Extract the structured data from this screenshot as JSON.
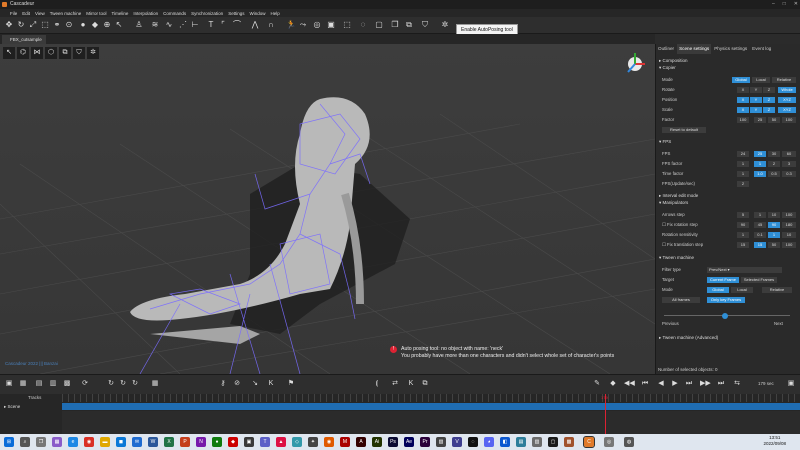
{
  "window": {
    "title": "Cascadeur"
  },
  "menu": [
    "File",
    "Edit",
    "View",
    "Tween machine",
    "Mirror tool",
    "Timeline",
    "Interpolation",
    "Commands",
    "Synchronization",
    "Settings",
    "Window",
    "Help"
  ],
  "toolbar_tooltip": "Enable AutoPosing tool",
  "scene_tab": "FBX_cutsample",
  "viewport": {
    "copyright": "Cascadeur 2022 ||| Banzai",
    "warning_line1": "Auto posing tool: no object with name: 'neck'",
    "warning_line2": "You probably have more than one characters and didn't select whole set of character's points"
  },
  "panel": {
    "tabs": [
      "Outliner",
      "Scene settings",
      "Physics settings",
      "Event log"
    ],
    "active_tab": "Scene settings",
    "composition": "Composition",
    "copier": "Copier",
    "mode": {
      "label": "Mode",
      "options": [
        "Global",
        "Local",
        "Relative"
      ]
    },
    "rotate": {
      "label": "Rotate",
      "options": [
        "X",
        "Y",
        "Z",
        "Whole"
      ]
    },
    "position": {
      "label": "Position",
      "options": [
        "X",
        "Y",
        "Z",
        "XYZ"
      ]
    },
    "scale": {
      "label": "Scale",
      "options": [
        "X",
        "Y",
        "Z",
        "XYZ"
      ]
    },
    "factor": {
      "label": "Factor",
      "options": [
        "100",
        "25",
        "50",
        "100"
      ]
    },
    "reset": "Reset to default",
    "fps_section": "FPS",
    "fps": {
      "label": "FPS",
      "options": [
        "24",
        "25",
        "30",
        "60"
      ]
    },
    "fps_factor": {
      "label": "FPS factor",
      "options": [
        "1",
        "1",
        "2",
        "3"
      ]
    },
    "time_factor": {
      "label": "Time factor",
      "options": [
        "1",
        "1.0",
        "0.5",
        "0.3"
      ]
    },
    "fps_update": {
      "label": "FPS(Update/sec)",
      "value": "2"
    },
    "interval": "Interval edit mode",
    "manipulators": "Manipulators",
    "arrows_step": {
      "label": "Arrows step",
      "options": [
        "5",
        "1",
        "10",
        "100"
      ]
    },
    "fix_rotation": {
      "label": "Fix rotation step",
      "options": [
        "90",
        "45",
        "90",
        "180"
      ]
    },
    "rot_sens": {
      "label": "Rotation sensitivity",
      "options": [
        "1",
        "0.1",
        "1",
        "10"
      ]
    },
    "fix_translation": {
      "label": "Fix translation step",
      "options": [
        "15",
        "15",
        "50",
        "100"
      ]
    },
    "tween": "Tween machine",
    "filter_type": {
      "label": "Filter type",
      "value": "Prev/Next"
    },
    "target": {
      "label": "Target",
      "options": [
        "Current Frame",
        "Selected Frames"
      ]
    },
    "tmode": {
      "label": "Mode",
      "options": [
        "Global",
        "Local",
        "Relative"
      ]
    },
    "keys": {
      "options": [
        "All frames",
        "Only key Frames"
      ]
    },
    "prev": "Previous",
    "next": "Next",
    "tween_adv": "Tween machine (Advanced)",
    "selected_count": "Number of selected objects: 0"
  },
  "timeline": {
    "tracks_label": "Tracks",
    "scene_label": "Scene",
    "current_frame": "179",
    "frame_count": "179 sec"
  },
  "taskbar": {
    "time": "13:51",
    "date": "2022/09/08"
  }
}
